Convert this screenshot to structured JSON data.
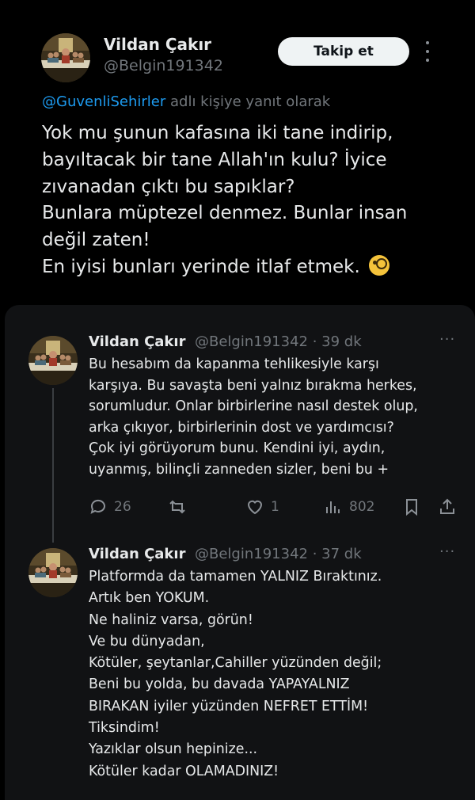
{
  "main_tweet": {
    "author_name": "Vildan Çakır",
    "handle": "@Belgin191342",
    "follow_label": "Takip et",
    "reply_to_handle": "@GuvenliSehirler",
    "reply_to_suffix": " adlı kişiye yanıt olarak",
    "text": "Yok mu şunun kafasına iki tane indirip,\nbayıltacak bir tane Allah'ın kulu? İyice\nzıvanadan çıktı bu sapıklar?\nBunlara müptezel denmez. Bunlar insan\ndeğil zaten!\nEn iyisi bunları yerinde itlaf etmek.",
    "emoji": "face-with-monocle"
  },
  "replies": [
    {
      "author_name": "Vildan Çakır",
      "meta": "@Belgin191342 · 39 dk",
      "more_label": "···",
      "text": "Bu hesabım da kapanma tehlikesiyle karşı\nkarşıya. Bu savaşta beni yalnız bırakma herkes,\nsorumludur. Onlar birbirlerine nasıl destek olup,\narka çıkıyor, birbirlerinin dost ve yardımcısı?\nÇok iyi görüyorum bunu. Kendini iyi, aydın,\nuyanmış, bilinçli zanneden sizler, beni bu +",
      "stats": {
        "replies": "26",
        "likes": "1",
        "views": "802"
      }
    },
    {
      "author_name": "Vildan Çakır",
      "meta": "@Belgin191342 · 37 dk",
      "more_label": "···",
      "text": "Platformda da tamamen YALNIZ Bıraktınız.\nArtık ben YOKUM.\nNe haliniz varsa, görün!\nVe bu dünyadan,\nKötüler, şeytanlar,Cahiller yüzünden değil;\nBeni bu yolda, bu davada YAPAYALNIZ\nBIRAKAN iyiler yüzünden NEFRET ETTİM!\nTiksindim!\nYazıklar olsun hepinize...\nKötüler kadar OLAMADINIZ!"
    }
  ],
  "icons": [
    "reply-icon",
    "retweet-icon",
    "like-icon",
    "views-icon",
    "bookmark-icon",
    "share-icon"
  ],
  "colors": {
    "background": "#000000",
    "panel": "#111214",
    "text": "#e7e9ea",
    "muted": "#71767b",
    "link": "#1d9bf0",
    "follow_button": "#eff3f4"
  }
}
